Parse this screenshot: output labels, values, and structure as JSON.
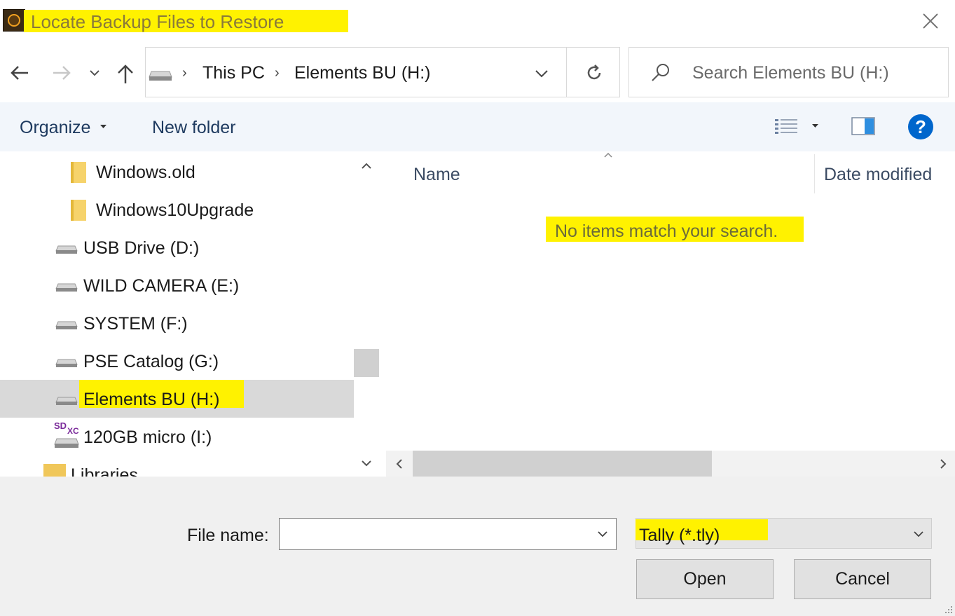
{
  "window": {
    "title": "Locate Backup Files to Restore"
  },
  "address_bar": {
    "breadcrumbs": [
      "This PC",
      "Elements BU (H:)"
    ],
    "search_placeholder": "Search Elements BU (H:)"
  },
  "toolbar": {
    "organize_label": "Organize",
    "new_folder_label": "New folder"
  },
  "nav_pane": {
    "items": [
      {
        "label": "Windows.old",
        "type": "folder"
      },
      {
        "label": "Windows10Upgrade",
        "type": "folder"
      },
      {
        "label": "USB Drive (D:)",
        "type": "drive"
      },
      {
        "label": "WILD CAMERA (E:)",
        "type": "drive"
      },
      {
        "label": "SYSTEM (F:)",
        "type": "drive"
      },
      {
        "label": "PSE Catalog (G:)",
        "type": "drive"
      },
      {
        "label": "Elements BU (H:)",
        "type": "drive",
        "selected": true
      },
      {
        "label": "120GB micro (I:)",
        "type": "sd-card"
      },
      {
        "label": "Libraries",
        "type": "library"
      }
    ],
    "sd_badge_top": "SD",
    "sd_badge_sub": "XC"
  },
  "file_list": {
    "columns": [
      "Name",
      "Date modified"
    ],
    "empty_message": "No items match your search."
  },
  "footer": {
    "file_name_label": "File name:",
    "file_name_value": "",
    "file_type_value": "Tally (*.tly)",
    "open_label": "Open",
    "cancel_label": "Cancel"
  },
  "colors": {
    "highlight": "#fff200",
    "selected_row": "#d9d9d9",
    "help_blue": "#0066cc"
  }
}
